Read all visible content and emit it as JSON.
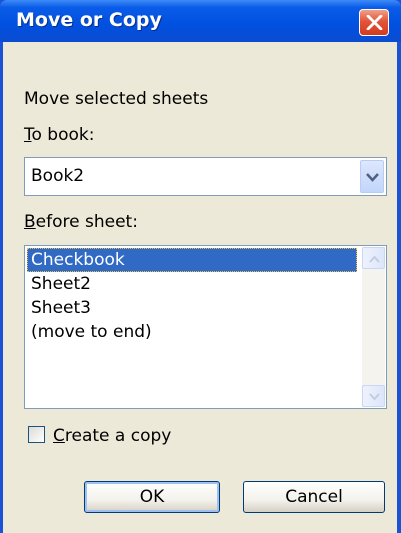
{
  "dialog": {
    "title": "Move or Copy",
    "close_icon": "close-x-icon",
    "heading": "Move selected sheets",
    "to_book": {
      "label_first": "T",
      "label_rest": "o book:",
      "value": "Book2"
    },
    "before_sheet": {
      "label_first": "B",
      "label_rest": "efore sheet:",
      "items": [
        "Checkbook",
        "Sheet2",
        "Sheet3",
        "(move to end)"
      ],
      "selected_index": 0
    },
    "create_copy": {
      "label_first": "C",
      "label_rest": "reate a copy",
      "checked": false
    },
    "ok_label": "OK",
    "cancel_label": "Cancel"
  },
  "colors": {
    "title_bar": "#0150e0",
    "dialog_background": "#ece9d8",
    "selection": "#316ac5",
    "close_button": "#e2553a"
  }
}
